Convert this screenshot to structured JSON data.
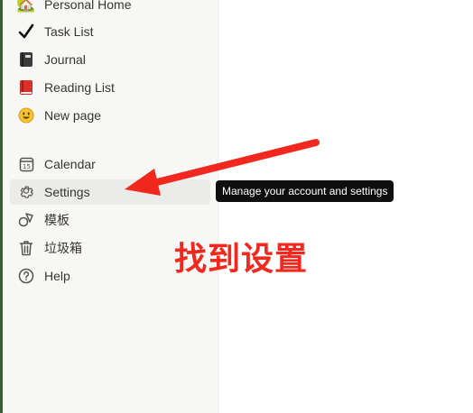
{
  "sidebar": {
    "pages": [
      {
        "label": "Personal Home",
        "icon": "house-icon"
      },
      {
        "label": "Task List",
        "icon": "checkmark-icon"
      },
      {
        "label": "Journal",
        "icon": "notebook-icon"
      },
      {
        "label": "Reading List",
        "icon": "red-book-icon"
      },
      {
        "label": "New page",
        "icon": "smiley-icon"
      }
    ],
    "tools": [
      {
        "label": "Calendar",
        "icon": "calendar-icon"
      },
      {
        "label": "Settings",
        "icon": "gear-icon"
      },
      {
        "label": "模板",
        "icon": "shapes-icon"
      },
      {
        "label": "垃圾箱",
        "icon": "trash-icon"
      },
      {
        "label": "Help",
        "icon": "question-icon"
      }
    ],
    "calendar_icon_day": "15"
  },
  "tooltip": {
    "text": "Manage your account and settings"
  },
  "annotation": {
    "text": "找到设置",
    "color": "#f0281e"
  },
  "colors": {
    "sidebar_bg": "#f7f7f5",
    "accent_red": "#f0281e",
    "tooltip_bg": "#0f0f0f"
  }
}
